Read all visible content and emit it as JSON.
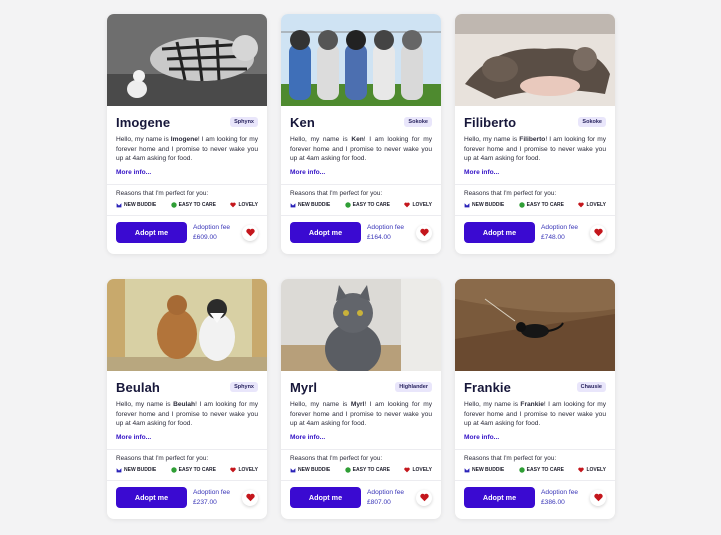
{
  "colors": {
    "accent": "#3a0ad1",
    "heart": "#c4161c",
    "green": "#2f9e35",
    "badge_bg": "#e9e6fb"
  },
  "card_common": {
    "desc_prefix": "Hello, my name is ",
    "desc_suffix": "! I am looking for my forever home and I promise to never wake you up at 4am asking for food.",
    "more_info": "More info...",
    "reasons_label": "Reasons that I'm perfect for you:",
    "tags": [
      "NEW BUDDIE",
      "EASY TO CARE",
      "LOVELY"
    ],
    "adopt_label": "Adopt me",
    "fee_label": "Adoption fee"
  },
  "cards": [
    {
      "name": "Imogene",
      "breed": "Sphynx",
      "fee": "£609.00",
      "photo": "tiger-and-cat"
    },
    {
      "name": "Ken",
      "breed": "Sokoke",
      "fee": "£164.00",
      "photo": "kittens-in-socks"
    },
    {
      "name": "Filiberto",
      "breed": "Sokoke",
      "fee": "£748.00",
      "photo": "sleeping-cat"
    },
    {
      "name": "Beulah",
      "breed": "Sphynx",
      "fee": "£237.00",
      "photo": "two-cats-window"
    },
    {
      "name": "Myrl",
      "breed": "Highlander",
      "fee": "£807.00",
      "photo": "gray-cat-sitting"
    },
    {
      "name": "Frankie",
      "breed": "Chausie",
      "fee": "£386.00",
      "photo": "black-cat-floor"
    }
  ]
}
